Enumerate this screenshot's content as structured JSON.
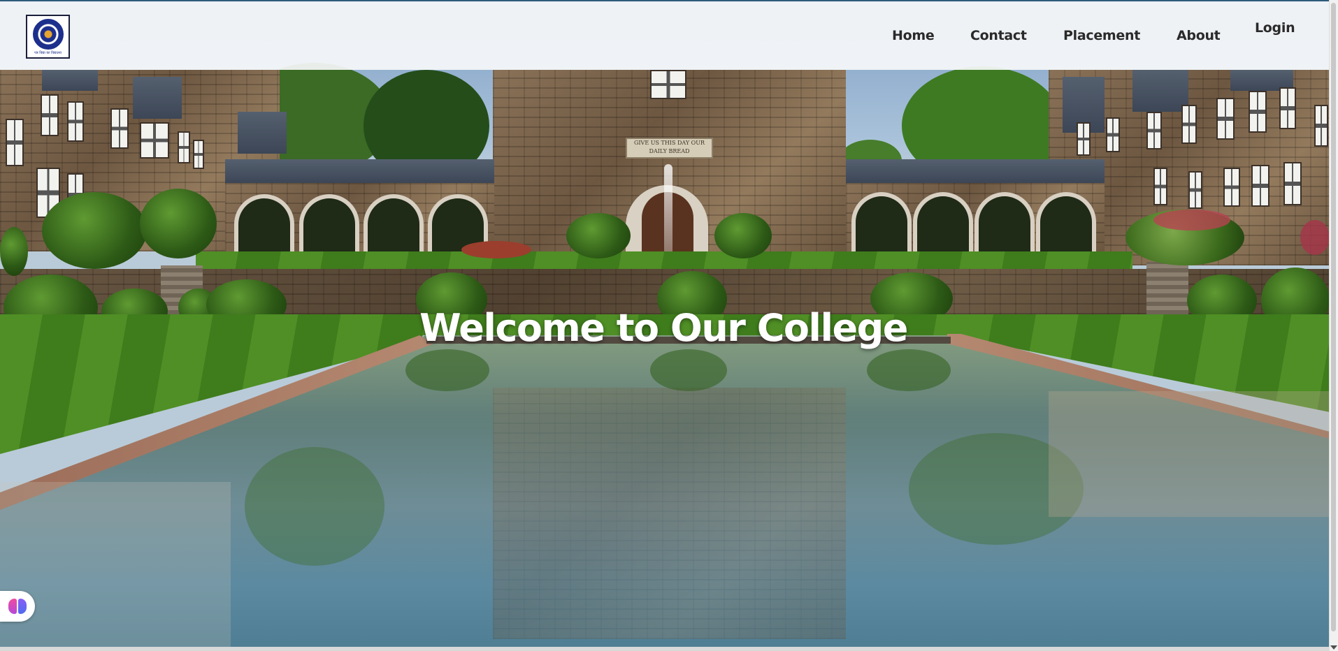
{
  "navbar": {
    "logo_motto": "पत्र विद्या का विद्यालय",
    "links": [
      "Home",
      "Contact",
      "Placement",
      "About"
    ],
    "login_label": "Login"
  },
  "hero": {
    "headline": "Welcome to Our College",
    "inscription": "GIVE US THIS DAY OUR DAILY BREAD"
  },
  "widget": {
    "icon": "brain-icon"
  }
}
